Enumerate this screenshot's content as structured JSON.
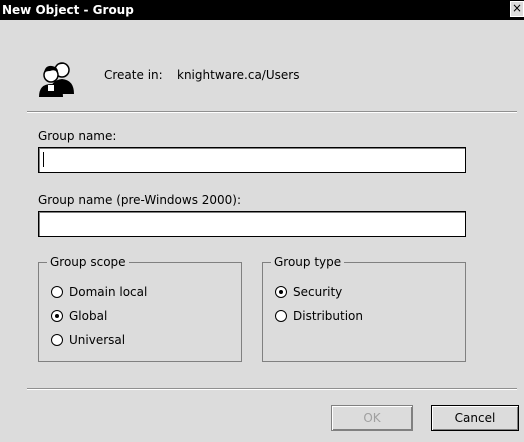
{
  "window": {
    "title": "New Object - Group",
    "close_label": "×"
  },
  "header": {
    "icon": "group-users-icon",
    "create_in_label": "Create in:",
    "create_in_value": "knightware.ca/Users"
  },
  "fields": {
    "group_name_label": "Group name:",
    "group_name_value": "",
    "pre2000_label": "Group name (pre-Windows 2000):",
    "pre2000_value": ""
  },
  "scope": {
    "title": "Group scope",
    "options": [
      {
        "label": "Domain local",
        "selected": false
      },
      {
        "label": "Global",
        "selected": true
      },
      {
        "label": "Universal",
        "selected": false
      }
    ]
  },
  "type": {
    "title": "Group type",
    "options": [
      {
        "label": "Security",
        "selected": true
      },
      {
        "label": "Distribution",
        "selected": false
      }
    ]
  },
  "buttons": {
    "ok_label": "OK",
    "ok_enabled": false,
    "cancel_label": "Cancel"
  }
}
